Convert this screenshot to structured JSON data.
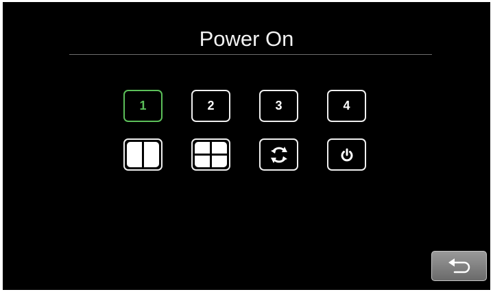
{
  "header": {
    "title": "Power On"
  },
  "channels": [
    {
      "label": "1",
      "active": true
    },
    {
      "label": "2",
      "active": false
    },
    {
      "label": "3",
      "active": false
    },
    {
      "label": "4",
      "active": false
    }
  ],
  "icons": {
    "row2": [
      "split-2-layout-icon",
      "quad-layout-icon",
      "cycle-icon",
      "power-icon"
    ],
    "back": "back-arrow-icon"
  },
  "colors": {
    "background": "#000000",
    "accent_active": "#5cc05a",
    "button_border": "#f0f0f0",
    "back_button": "#7f7f7f"
  }
}
